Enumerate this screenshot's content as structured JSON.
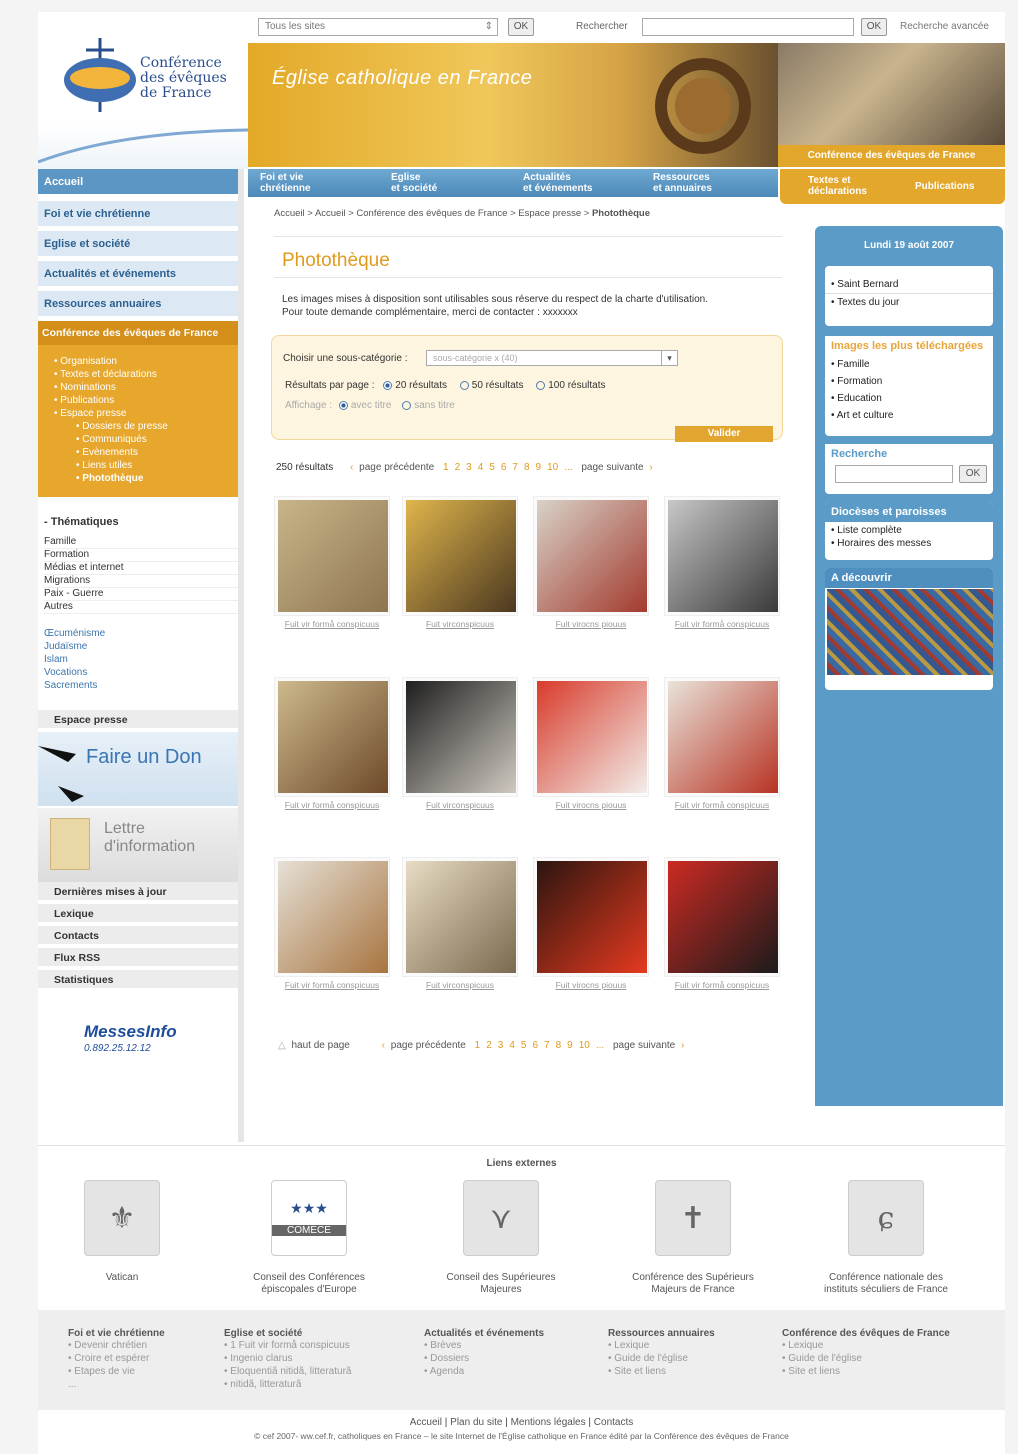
{
  "topbar": {
    "site_select": "Tous les sites",
    "ok": "OK",
    "search_label": "Rechercher",
    "search_ok": "OK",
    "advanced": "Recherche avancée"
  },
  "logo": {
    "line1": "Conférence",
    "line2": "des évêques",
    "line3": "de France"
  },
  "banner": {
    "title": "Église catholique en France",
    "photo_caption": "Conférence des évêques de France"
  },
  "main_nav": [
    {
      "l1": "Foi et vie",
      "l2": "chrétienne"
    },
    {
      "l1": "Eglise",
      "l2": "et société"
    },
    {
      "l1": "Actualités",
      "l2": "et événements"
    },
    {
      "l1": "Ressources",
      "l2": "et annuaires"
    }
  ],
  "right_nav": {
    "a1": "Textes et",
    "a2": "déclarations",
    "b": "Publications"
  },
  "left": {
    "home": "Accueil",
    "headers": [
      "Foi et vie chrétienne",
      "Eglise et société",
      "Actualités et événements",
      "Ressources annuaires"
    ],
    "conf_title": "Conférence des évêques de France",
    "conf_items": [
      "• Organisation",
      "• Textes et déclarations",
      "• Nominations",
      "• Publications",
      "• Espace presse"
    ],
    "conf_sub": [
      "• Dossiers de presse",
      "• Communiqués",
      "• Evènements",
      "• Liens utiles",
      "• Photothèque"
    ],
    "thematiques_title": "Thématiques",
    "thematiques": [
      "Famille",
      "Formation",
      "Médias et internet",
      "Migrations",
      "Paix - Guerre",
      "Autres"
    ],
    "others": [
      "Œcuménisme",
      "Judaïsme",
      "Islam",
      "Vocations",
      "Sacrements"
    ],
    "espace_presse": "Espace presse",
    "don": "Faire un Don",
    "lettre1": "Lettre",
    "lettre2": "d'information",
    "links": [
      "Dernières mises à jour",
      "Lexique",
      "Contacts",
      "Flux RSS",
      "Statistiques"
    ],
    "messes": "MessesInfo",
    "messes_num": "0.892.25.12.12"
  },
  "breadcrumb": {
    "a": "Accueil",
    "b": "Accueil",
    "c": "Conférence des évêques de France",
    "d": "Espace presse",
    "current": "Photothèque"
  },
  "content": {
    "title": "Photothèque",
    "intro1": "Les images mises à disposition sont utilisables sous réserve du respect de la charte d'utilisation.",
    "intro2": "Pour toute demande complémentaire, merci de contacter : xxxxxxx",
    "filter_label": "Choisir une sous-catégorie :",
    "filter_value": "sous-catégorie x (40)",
    "results_label": "Résultats par page :",
    "r20": "20 résultats",
    "r50": "50 résultats",
    "r100": "100 résultats",
    "display_label": "Affichage :",
    "avec": "avec titre",
    "sans": "sans titre",
    "valider": "Valider",
    "count": "250 résultats",
    "prev": "page précédente",
    "next": "page suivante",
    "pages": [
      "1",
      "2",
      "3",
      "4",
      "5",
      "6",
      "7",
      "8",
      "9",
      "10",
      "..."
    ],
    "top": "haut de page",
    "captions": [
      "Fuit vir formå conspicuus",
      "Fuit virconspicuus",
      "Fuit virocns piouus",
      "Fuit vir formå conspicuus"
    ]
  },
  "right": {
    "date": "Lundi 19 août 2007",
    "day": [
      "• Saint Bernard",
      "• Textes du jour"
    ],
    "images_title": "Images les plus téléchargées",
    "images": [
      "• Famille",
      "• Formation",
      "• Education",
      "• Art et culture"
    ],
    "search_title": "Recherche",
    "search_ok": "OK",
    "dioc_title": "Diocèses et paroisses",
    "dioc": [
      "• Liste complète",
      "• Horaires des messes"
    ],
    "decouvrir": "A découvrir"
  },
  "external": {
    "title": "Liens externes",
    "items": [
      {
        "l1": "Vatican",
        "l2": ""
      },
      {
        "l1": "Conseil des Conférences",
        "l2": "épiscopales d'Europe"
      },
      {
        "l1": "Conseil des Supérieures",
        "l2": "Majeures"
      },
      {
        "l1": "Conférence des Supérieurs",
        "l2": "Majeurs de France"
      },
      {
        "l1": "Conférence nationale des",
        "l2": "instituts séculiers de France"
      }
    ],
    "comece": "COMECE"
  },
  "footer": {
    "cols": [
      {
        "h": "Foi et vie chrétienne",
        "i": [
          "• Devenir chrétien",
          "• Croire et espérer",
          "• Etapes de vie",
          "..."
        ]
      },
      {
        "h": "Eglise et société",
        "i": [
          "• 1 Fuit vir formå conspicuus",
          "• Ingenio clarus",
          "• Eloquentiã nitidã, litteraturã",
          "• nitidã, litteraturã"
        ]
      },
      {
        "h": "Actualités et événements",
        "i": [
          "• Brèves",
          "• Dossiers",
          "• Agenda"
        ]
      },
      {
        "h": "Ressources annuaires",
        "i": [
          "• Lexique",
          "• Guide de l'église",
          "• Site et liens"
        ]
      },
      {
        "h": "Conférence des évêques de France",
        "i": [
          "• Lexique",
          "• Guide de l'église",
          "• Site et liens"
        ]
      }
    ],
    "legal": [
      "Accueil",
      "Plan du site",
      "Mentions légales",
      "Contacts"
    ],
    "copyright": "© cef 2007- ww.cef.fr, catholiques en France – le site Internet de l'Église catholique en France édité par la Conférence des évêques de France"
  },
  "colors": {
    "blue": "#5a9bc8",
    "orange": "#e3a72c",
    "title_orange": "#e09a1d"
  }
}
